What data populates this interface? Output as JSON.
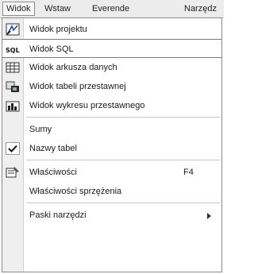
{
  "menubar": {
    "items": [
      {
        "label": "Widok"
      },
      {
        "label": "Wstaw"
      },
      {
        "label": "Everende"
      },
      {
        "label": "Narzędz"
      }
    ]
  },
  "menu": {
    "items": [
      {
        "label": "Widok projektu",
        "icon": "design-view-icon"
      },
      {
        "label": "Widok SQL",
        "icon": "sql-view-icon"
      },
      {
        "label": "Widok arkusza danych",
        "icon": "datasheet-view-icon"
      },
      {
        "label": "Widok tabeli przestawnej",
        "icon": "pivot-table-view-icon"
      },
      {
        "label": "Widok wykresu przestawnego",
        "icon": "pivot-chart-view-icon"
      },
      {
        "label": "Sumy"
      },
      {
        "label": "Nazwy tabel",
        "checked": true,
        "icon": "checkmark-icon"
      },
      {
        "label": "Właściwości",
        "shortcut": "F4",
        "icon": "properties-icon"
      },
      {
        "label": "Właściwości sprzężenia"
      },
      {
        "label": "Paski narzędzi",
        "submenu": true
      }
    ]
  }
}
